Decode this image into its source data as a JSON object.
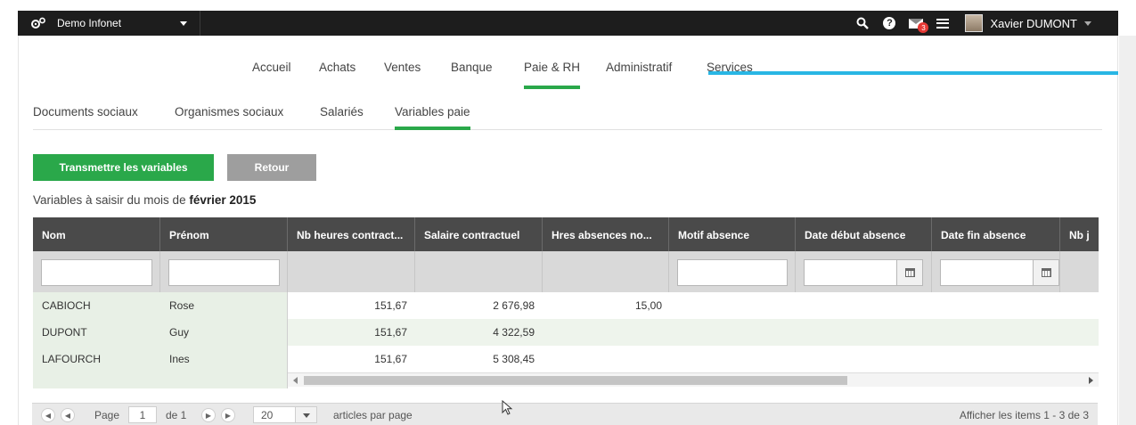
{
  "topbar": {
    "app_name": "Demo Infonet",
    "user_name": "Xavier DUMONT",
    "mail_count": "3",
    "help_glyph": "?"
  },
  "main_nav": [
    "Accueil",
    "Achats",
    "Ventes",
    "Banque",
    "Paie & RH",
    "Administratif",
    "Services"
  ],
  "main_nav_active": "Paie & RH",
  "sub_nav": [
    "Documents sociaux",
    "Organismes sociaux",
    "Salariés",
    "Variables paie"
  ],
  "sub_nav_active": "Variables paie",
  "actions": {
    "transmit_label": "Transmettre les variables",
    "back_label": "Retour"
  },
  "caption": {
    "prefix": "Variables à saisir du mois de ",
    "period": "février 2015"
  },
  "grid": {
    "columns": [
      "Nom",
      "Prénom",
      "Nb heures contract...",
      "Salaire contractuel",
      "Hres absences no...",
      "Motif absence",
      "Date début absence",
      "Date fin absence",
      "Nb j"
    ],
    "rows": [
      {
        "nom": "CABIOCH",
        "prenom": "Rose",
        "heures": "151,67",
        "salaire": "2 676,98",
        "absences": "15,00"
      },
      {
        "nom": "DUPONT",
        "prenom": "Guy",
        "heures": "151,67",
        "salaire": "4 322,59",
        "absences": ""
      },
      {
        "nom": "LAFOURCH",
        "prenom": "Ines",
        "heures": "151,67",
        "salaire": "5 308,45",
        "absences": ""
      }
    ]
  },
  "pager": {
    "page_label": "Page",
    "page_value": "1",
    "of_label": "de 1",
    "page_size": "20",
    "per_page_label": "articles par page",
    "items_info": "Afficher les items 1 - 3 de 3"
  },
  "colors": {
    "accent_green": "#2aa84a",
    "header_dark": "#4a4a4a",
    "topbar": "#1d1d1d",
    "annotation_blue": "#29b6e4"
  }
}
